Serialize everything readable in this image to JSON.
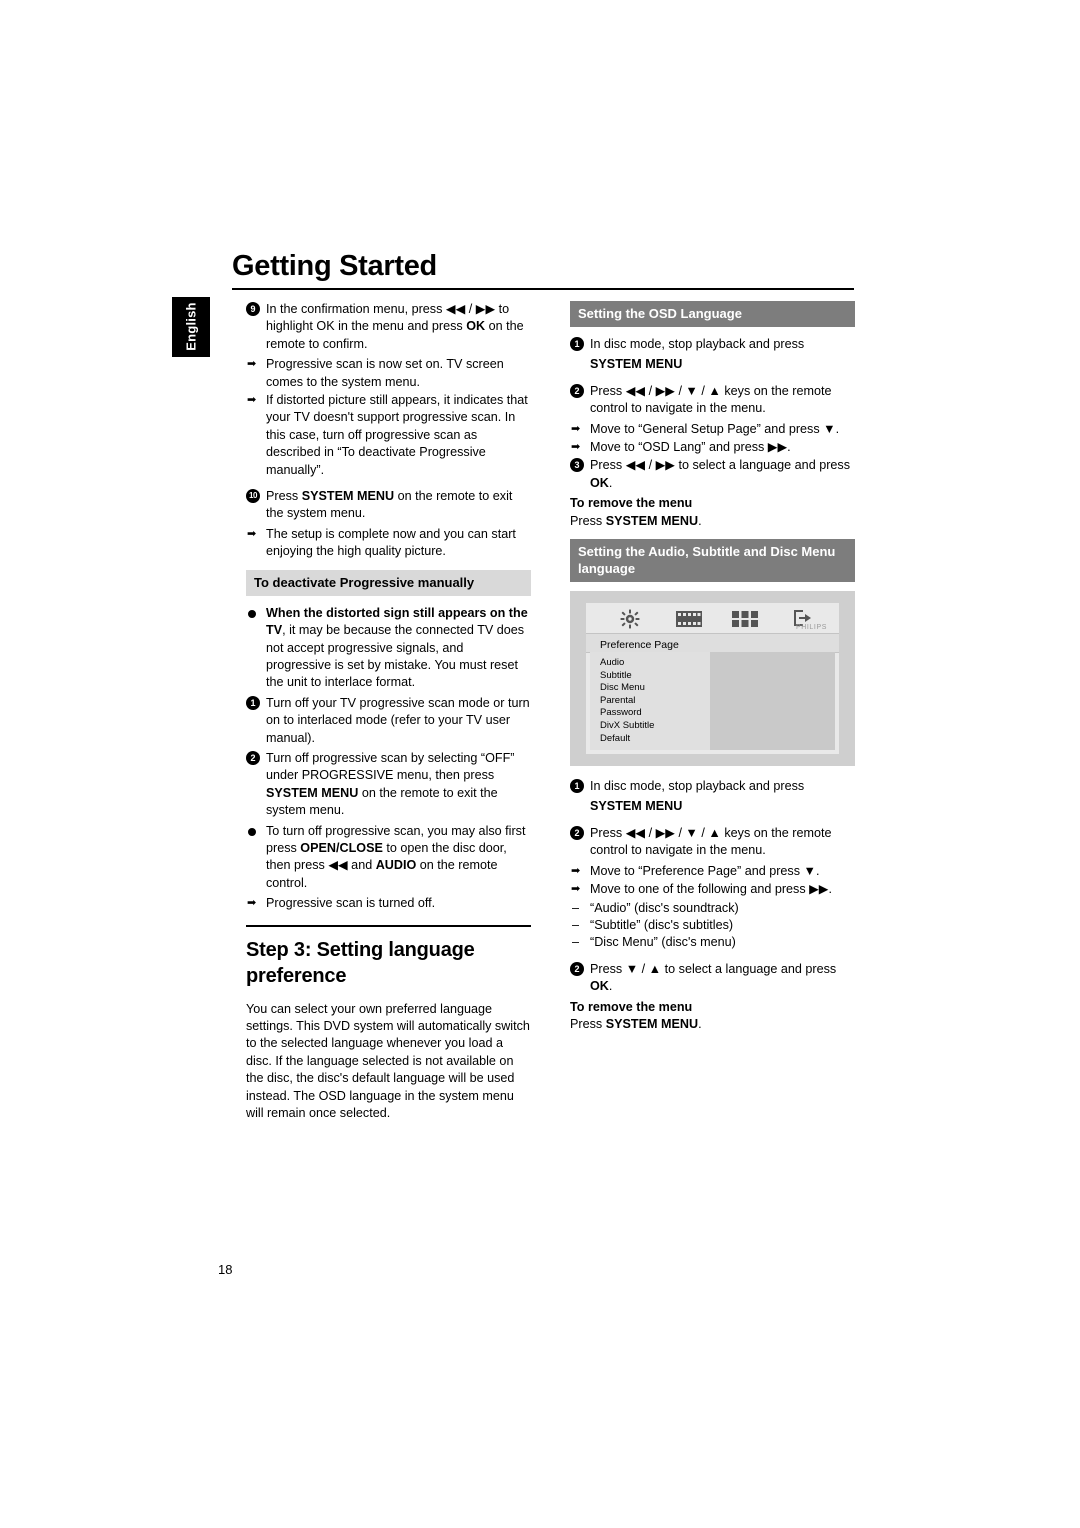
{
  "page": {
    "title": "Getting Started",
    "side_tab": "English",
    "page_number": "18"
  },
  "left_column": {
    "item9": {
      "num": "9",
      "line1_a": "In the confirmation menu, press ",
      "line1_icons": "◀◀ / ▶▶",
      "line1_b": " to highlight OK in the menu and press ",
      "ok": "OK",
      "line1_c": " on the remote to confirm.",
      "arrow1": "Progressive scan is now set on. TV screen comes to the system menu.",
      "arrow2": "If distorted picture still appears, it indicates that your TV doesn't support progressive scan. In this case, turn off progressive scan as described in “To deactivate Progressive manually”."
    },
    "item10": {
      "num": "10",
      "text_a": "Press ",
      "bold": "SYSTEM MENU",
      "text_b": " on the remote to exit the system menu.",
      "arrow1": "The setup is complete now and you can start enjoying the high quality picture."
    },
    "head_deactivate": "To deactivate Progressive manually",
    "bullet_distorted": {
      "bold_a": "When the distorted sign still appears on the TV",
      "rest": ", it may be because the connected TV does not accept progressive signals, and progressive is set by mistake. You must reset the unit to interlace format."
    },
    "step_items": [
      {
        "num": "1",
        "text": "Turn off your TV progressive scan mode or turn on to interlaced mode (refer to your TV user manual)."
      },
      {
        "num": "2",
        "text_a": "Turn off progressive scan by selecting “OFF” under PROGRESSIVE menu, then press ",
        "bold": "SYSTEM MENU",
        "text_b": " on the remote to exit the system menu."
      }
    ],
    "bullet_openclose": {
      "text_a": "To turn off progressive scan, you may also first press ",
      "bold1": "OPEN/CLOSE",
      "text_b": " to open the disc door, then press ",
      "icon": "◀◀",
      "text_c": " and ",
      "bold2": "AUDIO",
      "text_d": " on the remote control.",
      "arrow1": "Progressive scan is turned off."
    },
    "step3_title": "Step 3: Setting language preference",
    "step3_body": "You can select your own preferred language settings. This DVD system will automatically switch to the selected language whenever you load a disc. If the language selected is not available on the disc, the disc's default language will be used instead. The OSD language in the system menu will remain once selected."
  },
  "right_column": {
    "head_osd": "Setting the OSD Language",
    "osd_items": [
      {
        "num": "1",
        "text": "In disc mode, stop playback and press",
        "bold_next": "SYSTEM MENU"
      },
      {
        "num": "2",
        "text_a": "Press ",
        "icons": "◀◀ / ▶▶ / ▼ / ▲",
        "text_b": " keys on the remote control to navigate in the menu.",
        "arrow1_a": "Move to “General Setup Page” and press ",
        "arrow1_icon": "▼",
        "arrow1_b": ".",
        "arrow2_a": "Move to “OSD Lang” and press ",
        "arrow2_icon": "▶▶",
        "arrow2_b": "."
      },
      {
        "num": "3",
        "text_a": "Press ",
        "icons": "◀◀ / ▶▶",
        "text_b": " to select a language and press ",
        "bold": "OK",
        "text_c": "."
      }
    ],
    "remove_menu_1": {
      "heading": "To remove the menu",
      "text_a": "Press ",
      "bold": "SYSTEM MENU",
      "text_b": "."
    },
    "head_audio": "Setting the Audio, Subtitle and Disc Menu language",
    "tv_screen": {
      "page_label": "Preference Page",
      "menu_items": [
        "Audio",
        "Subtitle",
        "Disc Menu",
        "Parental",
        "Password",
        "DivX Subtitle",
        "Default"
      ],
      "brand": "PHILIPS",
      "icons": [
        "gear-setup-icon",
        "film-strip-icon",
        "grid-preference-icon",
        "exit-arrow-icon"
      ]
    },
    "audio_items": [
      {
        "num": "1",
        "text": "In disc mode, stop playback and press",
        "bold_next": "SYSTEM MENU"
      },
      {
        "num": "2",
        "text_a": "Press ",
        "icons": "◀◀ / ▶▶ / ▼ / ▲",
        "text_b": " keys on the remote control to navigate in the menu.",
        "arrow1_a": "Move to “Preference Page” and press ",
        "arrow1_icon": "▼",
        "arrow1_b": ".",
        "arrow2_a": "Move to one of the following and press ",
        "arrow2_icon": "▶▶",
        "arrow2_b": ".",
        "dashes": [
          "“Audio” (disc's soundtrack)",
          "“Subtitle” (disc's subtitles)",
          "“Disc Menu” (disc's menu)"
        ]
      },
      {
        "num": "2",
        "text_a": "Press ",
        "icons": "▼ / ▲",
        "text_b": " to select a language and press ",
        "bold": "OK",
        "text_c": "."
      }
    ],
    "remove_menu_2": {
      "heading": "To remove the menu",
      "text_a": "Press ",
      "bold": "SYSTEM MENU",
      "text_b": "."
    }
  }
}
